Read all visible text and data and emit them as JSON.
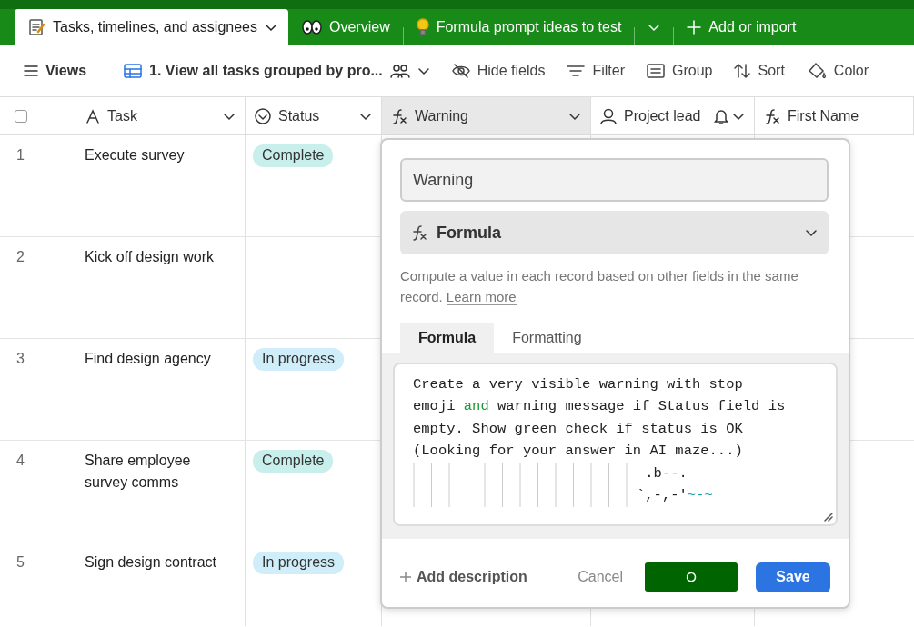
{
  "tabs": [
    {
      "label": "Tasks, timelines, and assignees",
      "kind": "notes",
      "selected": true,
      "dropdown": true
    },
    {
      "label": "Overview",
      "kind": "eyes",
      "selected": false,
      "dropdown": false
    },
    {
      "label": "Formula prompt ideas to test",
      "kind": "bulb",
      "selected": false,
      "dropdown": false
    }
  ],
  "add_tab": {
    "label": "Add or import"
  },
  "toolbar": {
    "views": "Views",
    "view_name": "1. View all tasks grouped by pro...",
    "actions": [
      {
        "label": "Hide fields",
        "kind": "hide"
      },
      {
        "label": "Filter",
        "kind": "filter"
      },
      {
        "label": "Group",
        "kind": "group"
      },
      {
        "label": "Sort",
        "kind": "sort"
      },
      {
        "label": "Color",
        "kind": "color"
      }
    ]
  },
  "table": {
    "select_all": {
      "checked": false
    },
    "columns": [
      {
        "label": "Task",
        "kind": "text",
        "selected": false,
        "bell": false
      },
      {
        "label": "Status",
        "kind": "status",
        "selected": false,
        "bell": false
      },
      {
        "label": "Warning",
        "kind": "formula",
        "selected": true,
        "bell": false
      },
      {
        "label": "Project lead",
        "kind": "person",
        "selected": false,
        "bell": true
      },
      {
        "label": "First Name",
        "kind": "formula",
        "selected": false,
        "bell": false
      }
    ],
    "rows": [
      {
        "number": "1",
        "task": "Execute survey",
        "status": {
          "label": "Complete",
          "kind": "complete"
        }
      },
      {
        "number": "2",
        "task": "Kick off design work",
        "status": null
      },
      {
        "number": "3",
        "task": "Find design agency",
        "status": {
          "label": "In progress",
          "kind": "progress"
        }
      },
      {
        "number": "4",
        "task": "Share employee survey comms",
        "status": {
          "label": "Complete",
          "kind": "complete"
        }
      },
      {
        "number": "5",
        "task": "Sign design contract",
        "status": {
          "label": "In progress",
          "kind": "progress"
        }
      }
    ]
  },
  "field_editor": {
    "name": "Warning",
    "type": "Formula",
    "description": "Compute a value in each record based on other fields in the same record.",
    "learn_more": "Learn more",
    "tabs": [
      {
        "label": "Formula",
        "selected": true
      },
      {
        "label": "Formatting",
        "selected": false
      }
    ],
    "formula_lines": [
      [
        {
          "text": "Create a very visible warning with stop",
          "kind": "plain"
        }
      ],
      [
        {
          "text": "emoji ",
          "kind": "plain"
        },
        {
          "text": "and",
          "kind": "keyword"
        },
        {
          "text": " warning message if Status field is",
          "kind": "plain"
        }
      ],
      [
        {
          "text": "empty. Show green check if status is OK",
          "kind": "plain"
        }
      ],
      [
        {
          "text": "(Looking for your answer in AI maze...)",
          "kind": "plain"
        }
      ]
    ],
    "art_lines": [
      [
        {
          "text": " .b--.",
          "kind": "plain"
        }
      ],
      [
        {
          "text": "`,-,-'",
          "kind": "plain"
        },
        {
          "text": "~-~",
          "kind": "string"
        }
      ]
    ],
    "add_description": "Add description",
    "cancel": "Cancel",
    "save": "Save"
  }
}
